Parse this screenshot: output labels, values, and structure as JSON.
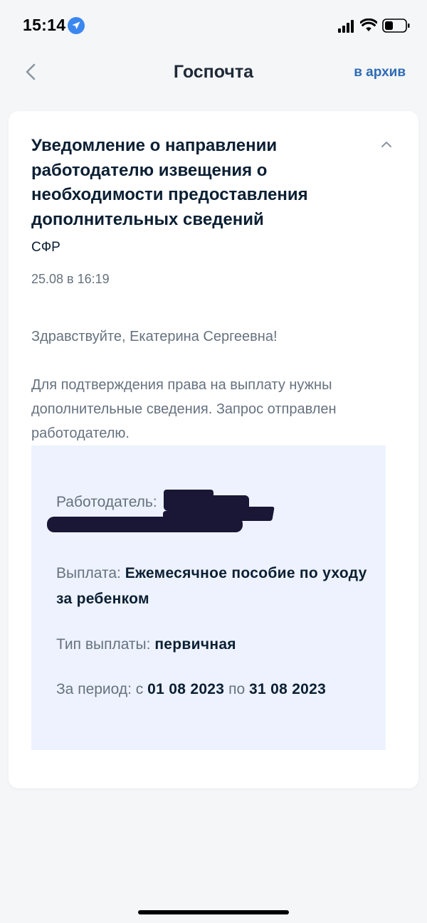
{
  "status_bar": {
    "time": "15:14"
  },
  "nav": {
    "title": "Госпочта",
    "archive_label": "в архив"
  },
  "message": {
    "title": "Уведомление о направлении работодателю извещения о необходимости предоставления дополнительных сведений",
    "sender": "СФР",
    "date": "25.08 в 16:19",
    "greeting": "Здравствуйте, Екатерина Сергеевна!",
    "body": "Для подтверждения права на выплату нужны дополнительные сведения. Запрос отправлен работодателю.",
    "details": {
      "employer_label": "Работодатель:",
      "payment_label": "Выплата:",
      "payment_value": "Ежемесячное пособие по уходу за ребенком",
      "type_label": "Тип выплаты:",
      "type_value": "первичная",
      "period_label_from": "За период: с",
      "period_from": "01 08 2023",
      "period_label_to": "по",
      "period_to": "31 08 2023"
    }
  },
  "colors": {
    "accent": "#2d6bb5",
    "muted_text": "#66727f",
    "primary_text": "#0b1f33",
    "details_bg": "#edf2fe",
    "page_bg": "#f5f6f8",
    "location_icon": "#3a87f0"
  },
  "icons": [
    "location-arrow-icon",
    "signal-icon",
    "wifi-icon",
    "battery-icon",
    "chevron-left-icon",
    "chevron-up-icon"
  ]
}
